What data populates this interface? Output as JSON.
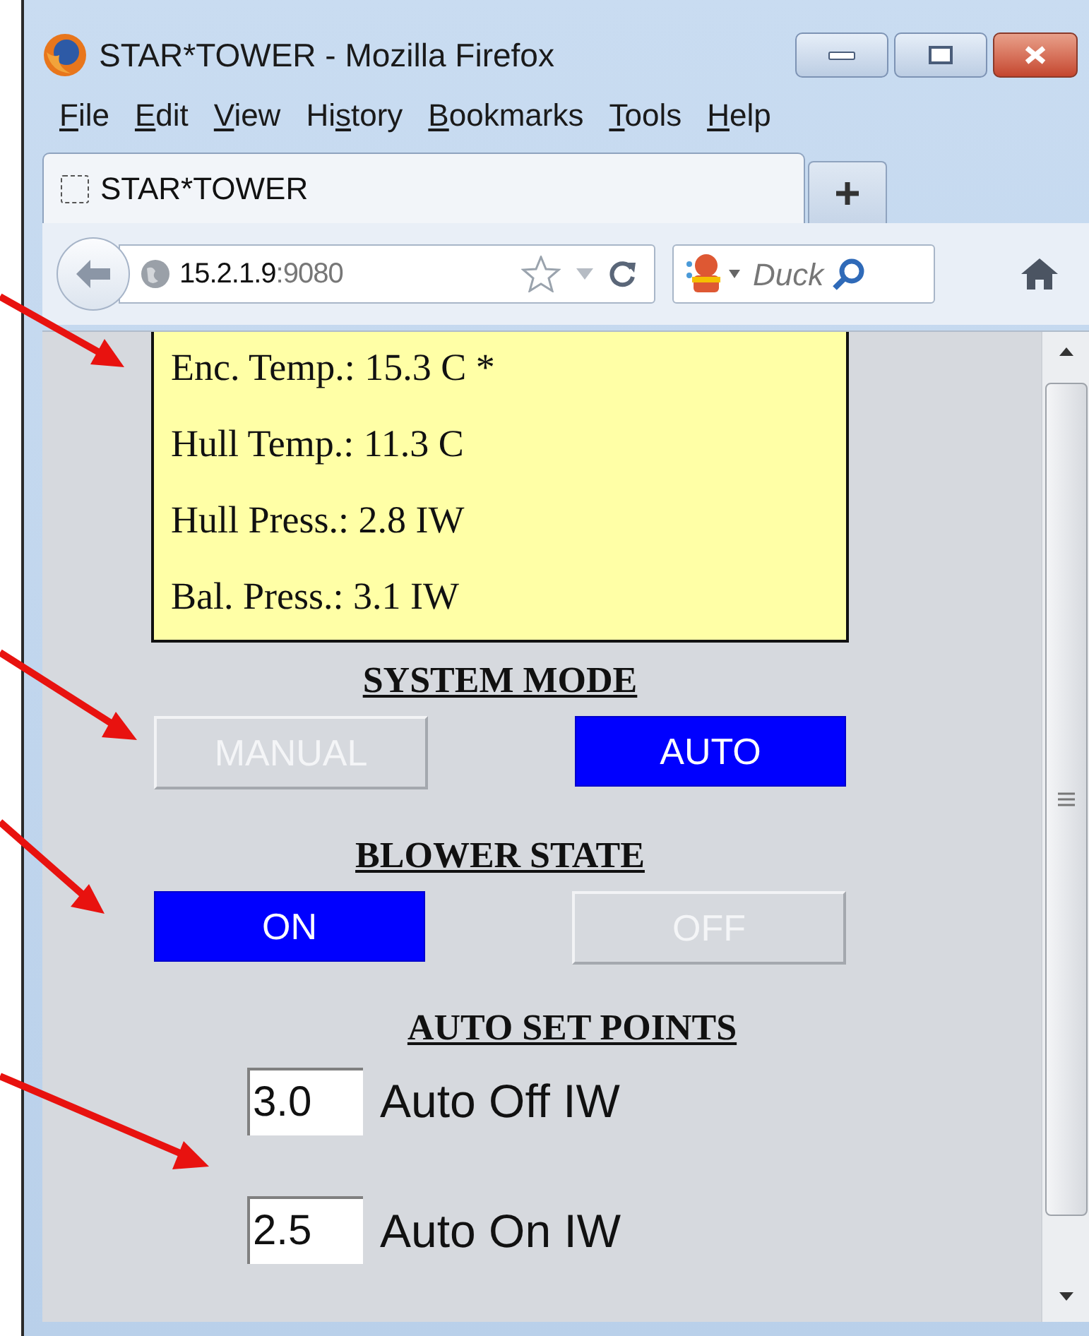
{
  "window": {
    "title": "STAR*TOWER - Mozilla Firefox"
  },
  "menu": [
    {
      "key": "F",
      "after": "ile"
    },
    {
      "key": "E",
      "after": "dit"
    },
    {
      "key": "V",
      "after": "iew"
    },
    {
      "before": "Hi",
      "key": "s",
      "after": "tory"
    },
    {
      "key": "B",
      "after": "ookmarks"
    },
    {
      "key": "T",
      "after": "ools"
    },
    {
      "key": "H",
      "after": "elp"
    }
  ],
  "tabs": [
    {
      "label": "STAR*TOWER",
      "selected": true
    }
  ],
  "address_bar": {
    "host": "15.2.1.9",
    "port": ":9080"
  },
  "search": {
    "placeholder": "Duck"
  },
  "readings": [
    "Enc. Temp.: 15.3 C *",
    "Hull Temp.: 11.3 C",
    "Hull Press.: 2.8 IW",
    "Bal. Press.: 3.1 IW"
  ],
  "system_mode": {
    "title": "SYSTEM MODE",
    "options": [
      {
        "label": "MANUAL",
        "selected": false
      },
      {
        "label": "AUTO",
        "selected": true
      }
    ]
  },
  "blower_state": {
    "title": "BLOWER STATE",
    "options": [
      {
        "label": "ON",
        "selected": true
      },
      {
        "label": "OFF",
        "selected": false
      }
    ]
  },
  "auto_set_points": {
    "title": "AUTO SET POINTS",
    "fields": [
      {
        "value": "3.0",
        "label": "Auto Off IW"
      },
      {
        "value": "2.5",
        "label": "Auto On IW"
      }
    ]
  }
}
